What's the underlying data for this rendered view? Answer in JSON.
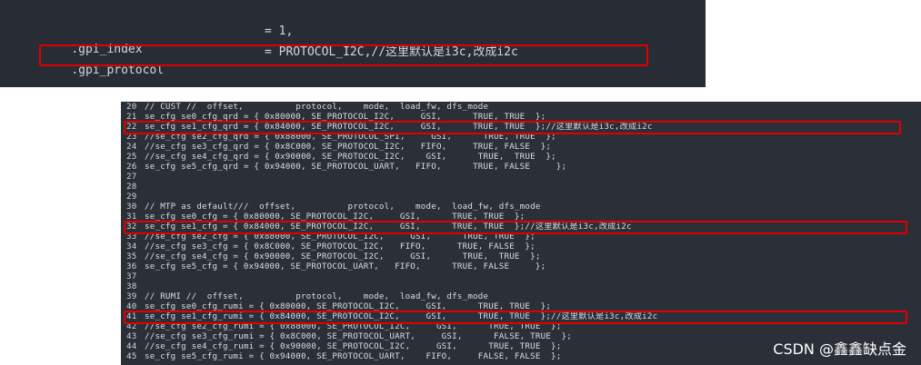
{
  "top_snippet": {
    "line1": {
      "field": ".gpi_index",
      "value": "= 1,"
    },
    "line2": {
      "field": ".gpi_protocol",
      "value": "= PROTOCOL_I2C,//这里默认是i3c,改成i2c"
    }
  },
  "code": {
    "lines": [
      {
        "n": "20",
        "text": "// CUST //  offset,          protocol,    mode,  load_fw, dfs_mode"
      },
      {
        "n": "21",
        "text": "se_cfg se0_cfg_qrd = { 0x80000, SE_PROTOCOL_I2C,     GSI,      TRUE, TRUE  };"
      },
      {
        "n": "22",
        "text": "se_cfg se1_cfg_qrd = { 0x84000, SE_PROTOCOL_I2C,     GSI,      TRUE, TRUE  };//这里默认是i3c,改成i2c"
      },
      {
        "n": "23",
        "text": "//se_cfg se2_cfg_qrd = { 0x88000, SE_PROTOCOL_SPI,     GSI,      TRUE, TRUE  };"
      },
      {
        "n": "24",
        "text": "//se_cfg se3_cfg_qrd = { 0x8C000, SE_PROTOCOL_I2C,   FIFO,     TRUE, FALSE  };"
      },
      {
        "n": "25",
        "text": "//se_cfg se4_cfg_qrd = { 0x90000, SE_PROTOCOL_I2C,    GSI,      TRUE,  TRUE  };"
      },
      {
        "n": "26",
        "text": "se_cfg se5_cfg_qrd = { 0x94000, SE_PROTOCOL_UART,   FIFO,      TRUE, FALSE     };"
      },
      {
        "n": "27",
        "text": ""
      },
      {
        "n": "28",
        "text": ""
      },
      {
        "n": "29",
        "text": ""
      },
      {
        "n": "30",
        "text": "// MTP as default///  offset,          protocol,    mode,  load_fw, dfs_mode"
      },
      {
        "n": "31",
        "text": "se_cfg se0_cfg = { 0x80000, SE_PROTOCOL_I2C,     GSI,      TRUE, TRUE  };"
      },
      {
        "n": "32",
        "text": "se_cfg se1_cfg = { 0x84000, SE_PROTOCOL_I2C,     GSI,      TRUE, TRUE  };//这里默认是i3c,改成i2c"
      },
      {
        "n": "33",
        "text": "//se_cfg se2_cfg = { 0x88000, SE_PROTOCOL_I2C,     GSI,      TRUE, TRUE  };"
      },
      {
        "n": "34",
        "text": "//se_cfg se3_cfg = { 0x8C000, SE_PROTOCOL_I2C,   FIFO,      TRUE, FALSE  };"
      },
      {
        "n": "35",
        "text": "//se_cfg se4_cfg = { 0x90000, SE_PROTOCOL_I2C,     GSI,      TRUE,  TRUE  };"
      },
      {
        "n": "36",
        "text": "se_cfg se5_cfg = { 0x94000, SE_PROTOCOL_UART,   FIFO,      TRUE, FALSE     };"
      },
      {
        "n": "37",
        "text": ""
      },
      {
        "n": "38",
        "text": ""
      },
      {
        "n": "39",
        "text": "// RUMI //  offset,          protocol,    mode,  load_fw, dfs_mode"
      },
      {
        "n": "40",
        "text": "se_cfg se0_cfg_rumi = { 0x80000, SE_PROTOCOL_I2C,     GSI,      TRUE, TRUE  };"
      },
      {
        "n": "41",
        "text": "se_cfg se1_cfg_rumi = { 0x84000, SE_PROTOCOL_I2C,     GSI,      TRUE, TRUE  };//这里默认是i3c,改成i2c"
      },
      {
        "n": "42",
        "text": "//se_cfg se2_cfg_rumi = { 0x88000, SE_PROTOCOL_I2C,     GSI,      TRUE, TRUE  };"
      },
      {
        "n": "43",
        "text": "//se_cfg se3_cfg_rumi = { 0x8C000, SE_PROTOCOL_UART,     GSI,      FALSE, TRUE  };"
      },
      {
        "n": "44",
        "text": "//se_cfg se4_cfg_rumi = { 0x90000, SE_PROTOCOL_I2C,     GSI,      TRUE, TRUE  };"
      },
      {
        "n": "45",
        "text": "se_cfg se5_cfg_rumi = { 0x94000, SE_PROTOCOL_UART,    FIFO,     FALSE, FALSE  };"
      }
    ]
  },
  "watermark": "CSDN @鑫鑫缺点金",
  "colors": {
    "panel_bg": "#282c34",
    "highlight": "#e00000",
    "text": "#dadde2"
  }
}
